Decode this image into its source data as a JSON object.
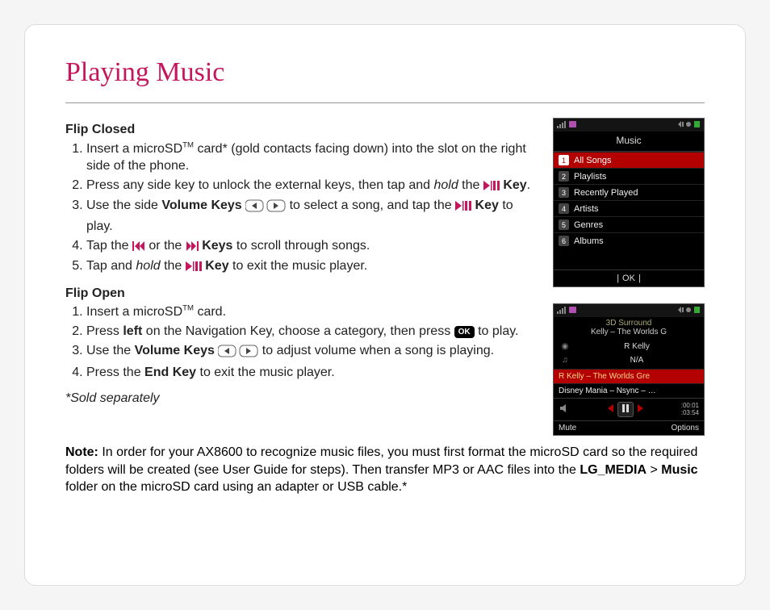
{
  "title": "Playing Music",
  "sections": {
    "flip_closed": {
      "heading": "Flip Closed",
      "steps": [
        {
          "pre": "Insert a microSD",
          "tm": "TM",
          "post": " card* (gold contacts facing down) into the slot on the right side of the phone."
        },
        {
          "pre": "Press any side key to unlock the external keys, then tap and ",
          "em": "hold",
          "post1": " the ",
          "icon": "playpause",
          "b": " Key",
          "post2": "."
        },
        {
          "pre": "Use the side ",
          "b1": "Volume Keys",
          "icon": "volume",
          "post1": " to select a song, and tap the ",
          "icon2": "playpause",
          "b2": "Key",
          "post2": " to play."
        },
        {
          "pre": "Tap the ",
          "icon": "prev",
          "mid": "or the ",
          "icon2": "next",
          "b": "Keys",
          "post": " to scroll through songs."
        },
        {
          "pre": "Tap and ",
          "em": "hold",
          "post1": " the ",
          "icon": "playpause",
          "b": "Key",
          "post2": " to exit the music player."
        }
      ]
    },
    "flip_open": {
      "heading": "Flip Open",
      "steps": [
        {
          "pre": "Insert a microSD",
          "tm": "TM",
          "post": " card."
        },
        {
          "pre": "Press ",
          "b1": "left",
          "post1": " on the Navigation Key, choose a category, then press ",
          "ok": "OK",
          "post2": " to play."
        },
        {
          "pre": "Use the ",
          "b1": "Volume Keys",
          "icon": "volume",
          "post": " to adjust volume when a song is playing."
        },
        {
          "pre": "Press the ",
          "b1": "End Key",
          "post": " to exit the music player."
        }
      ]
    }
  },
  "footnote": "*Sold separately",
  "note": {
    "label": "Note:",
    "text1": " In order for your AX8600 to recognize music files, you must first format the microSD card so the required folders will be created (see User Guide for steps). Then transfer MP3 or AAC files into the ",
    "path1": "LG_MEDIA",
    "sep": " > ",
    "path2": "Music",
    "text2": " folder on the microSD card using an adapter or USB cable.*"
  },
  "phone1": {
    "title": "Music",
    "items": [
      {
        "n": "1",
        "t": "All Songs"
      },
      {
        "n": "2",
        "t": "Playlists"
      },
      {
        "n": "3",
        "t": "Recently Played"
      },
      {
        "n": "4",
        "t": "Artists"
      },
      {
        "n": "5",
        "t": "Genres"
      },
      {
        "n": "6",
        "t": "Albums"
      }
    ],
    "soft": "OK"
  },
  "phone2": {
    "np_label": "3D Surround",
    "np_song": "Kelly – The Worlds G",
    "artist": "R Kelly",
    "album": "N/A",
    "track_sel": "R Kelly – The Worlds Gre",
    "track_next": "Disney Mania – Nsync – …",
    "time_el": ":00:01",
    "time_tot": ":03:54",
    "soft_left": "Mute",
    "soft_right": "Options"
  },
  "icons": {
    "disc": "◉",
    "note": "♫"
  }
}
